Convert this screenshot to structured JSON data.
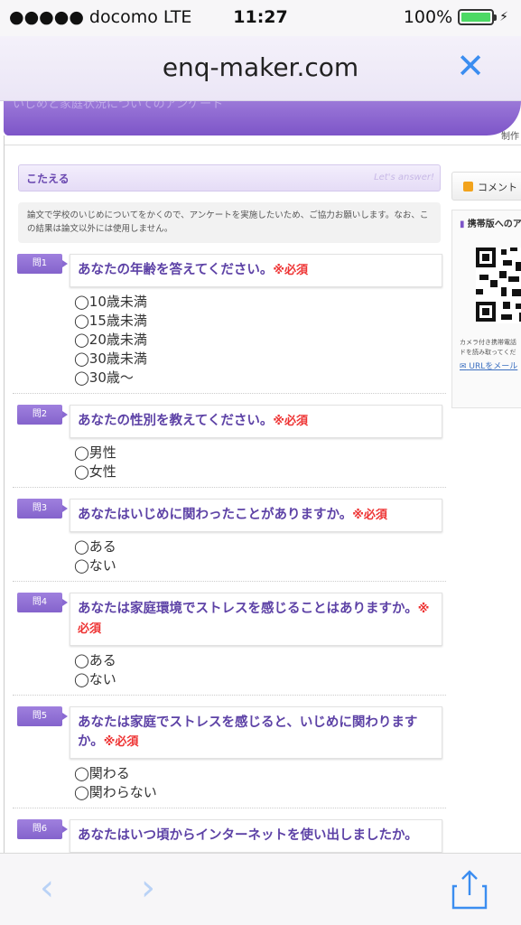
{
  "status_bar": {
    "carrier": "●●●●● docomo  LTE",
    "time": "11:27",
    "battery": "100%"
  },
  "url_bar": {
    "domain": "enq-maker.com"
  },
  "banner": {
    "title": "いじめと家庭状況についてのアンケート",
    "seisaku": "制作"
  },
  "answer_header": {
    "title": "こたえる",
    "tagline": "Let's answer!"
  },
  "intro": "論文で学校のいじめについてをかくので、アンケートを実施したいため、ご協力お願いします。なお、この結果は論文以外には使用しません。",
  "questions": [
    {
      "tag": "問1",
      "text": "あなたの年齢を答えてください。",
      "required": "※必須",
      "options": [
        "◯10歳未満",
        "◯15歳未満",
        "◯20歳未満",
        "◯30歳未満",
        "◯30歳〜"
      ]
    },
    {
      "tag": "問2",
      "text": "あなたの性別を教えてください。",
      "required": "※必須",
      "options": [
        "◯男性",
        "◯女性"
      ]
    },
    {
      "tag": "問3",
      "text": "あなたはいじめに関わったことがありますか。",
      "required": "※必須",
      "options": [
        "◯ある",
        "◯ない"
      ]
    },
    {
      "tag": "問4",
      "text": "あなたは家庭環境でストレスを感じることはありますか。",
      "required": "※必須",
      "options": [
        "◯ある",
        "◯ない"
      ]
    },
    {
      "tag": "問5",
      "text": "あなたは家庭でストレスを感じると、いじめに関わりますか。",
      "required": "※必須",
      "options": [
        "◯関わる",
        "◯関わらない"
      ]
    },
    {
      "tag": "問6",
      "text": "あなたはいつ頃からインターネットを使い出しましたか。",
      "required": "",
      "options": []
    }
  ],
  "sidebar": {
    "comment_label": "コメント",
    "mobile_title": "携帯版へのア",
    "small_text_1": "カメラ付き携帯電話",
    "small_text_2": "ドを読み取ってくだ",
    "url_mail_link": "URLをメール"
  },
  "colors": {
    "accent_purple": "#7d55c8",
    "question_text": "#5d42a6",
    "required_red": "#e33333",
    "ios_blue": "#3b8df0"
  }
}
